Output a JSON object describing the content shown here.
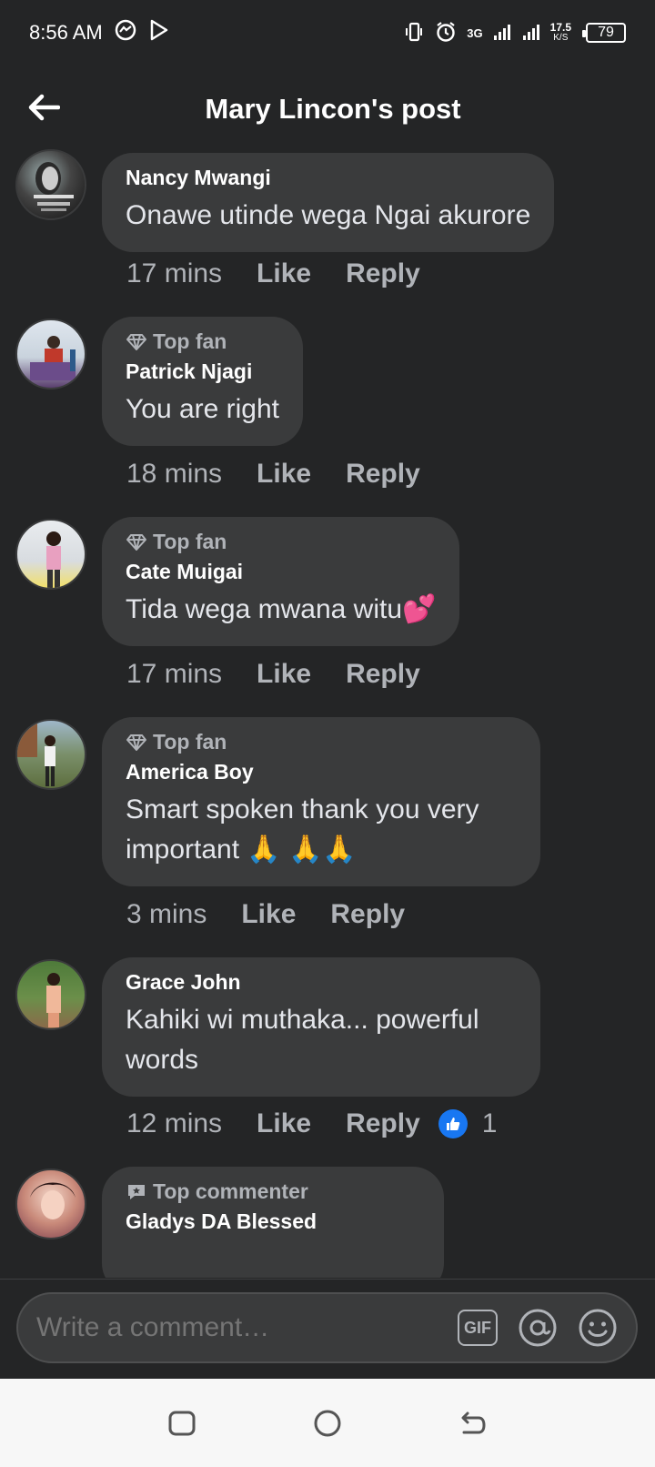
{
  "status_bar": {
    "time": "8:56 AM",
    "net_label": "3G",
    "speed_value": "17.5",
    "speed_unit": "K/S",
    "battery": "79"
  },
  "header": {
    "title": "Mary Lincon's post",
    "back_icon": "back-arrow-icon"
  },
  "comments": [
    {
      "badge": "",
      "author": "Nancy Mwangi",
      "text": "Onawe utinde wega Ngai akurore",
      "time": "17 mins",
      "like_label": "Like",
      "reply_label": "Reply",
      "reaction_count": ""
    },
    {
      "badge": "Top fan",
      "author": "Patrick Njagi",
      "text": "You are right",
      "time": "18 mins",
      "like_label": "Like",
      "reply_label": "Reply",
      "reaction_count": ""
    },
    {
      "badge": "Top fan",
      "author": "Cate Muigai",
      "text": "Tida wega mwana witu💕",
      "time": "17 mins",
      "like_label": "Like",
      "reply_label": "Reply",
      "reaction_count": ""
    },
    {
      "badge": "Top fan",
      "author": "America Boy",
      "text": "Smart  spoken thank you very important 🙏 🙏🙏",
      "time": "3 mins",
      "like_label": "Like",
      "reply_label": "Reply",
      "reaction_count": ""
    },
    {
      "badge": "",
      "author": "Grace John",
      "text": "Kahiki wi muthaka... powerful words",
      "time": "12 mins",
      "like_label": "Like",
      "reply_label": "Reply",
      "reaction_count": "1"
    },
    {
      "badge": "Top commenter",
      "author": "Gladys DA Blessed",
      "text": "",
      "time": "",
      "like_label": "",
      "reply_label": "",
      "reaction_count": ""
    }
  ],
  "composer": {
    "placeholder": "Write a comment…",
    "gif_label": "GIF"
  },
  "colors": {
    "background": "#242526",
    "bubble": "#3a3b3c",
    "like_blue": "#1877f2"
  }
}
